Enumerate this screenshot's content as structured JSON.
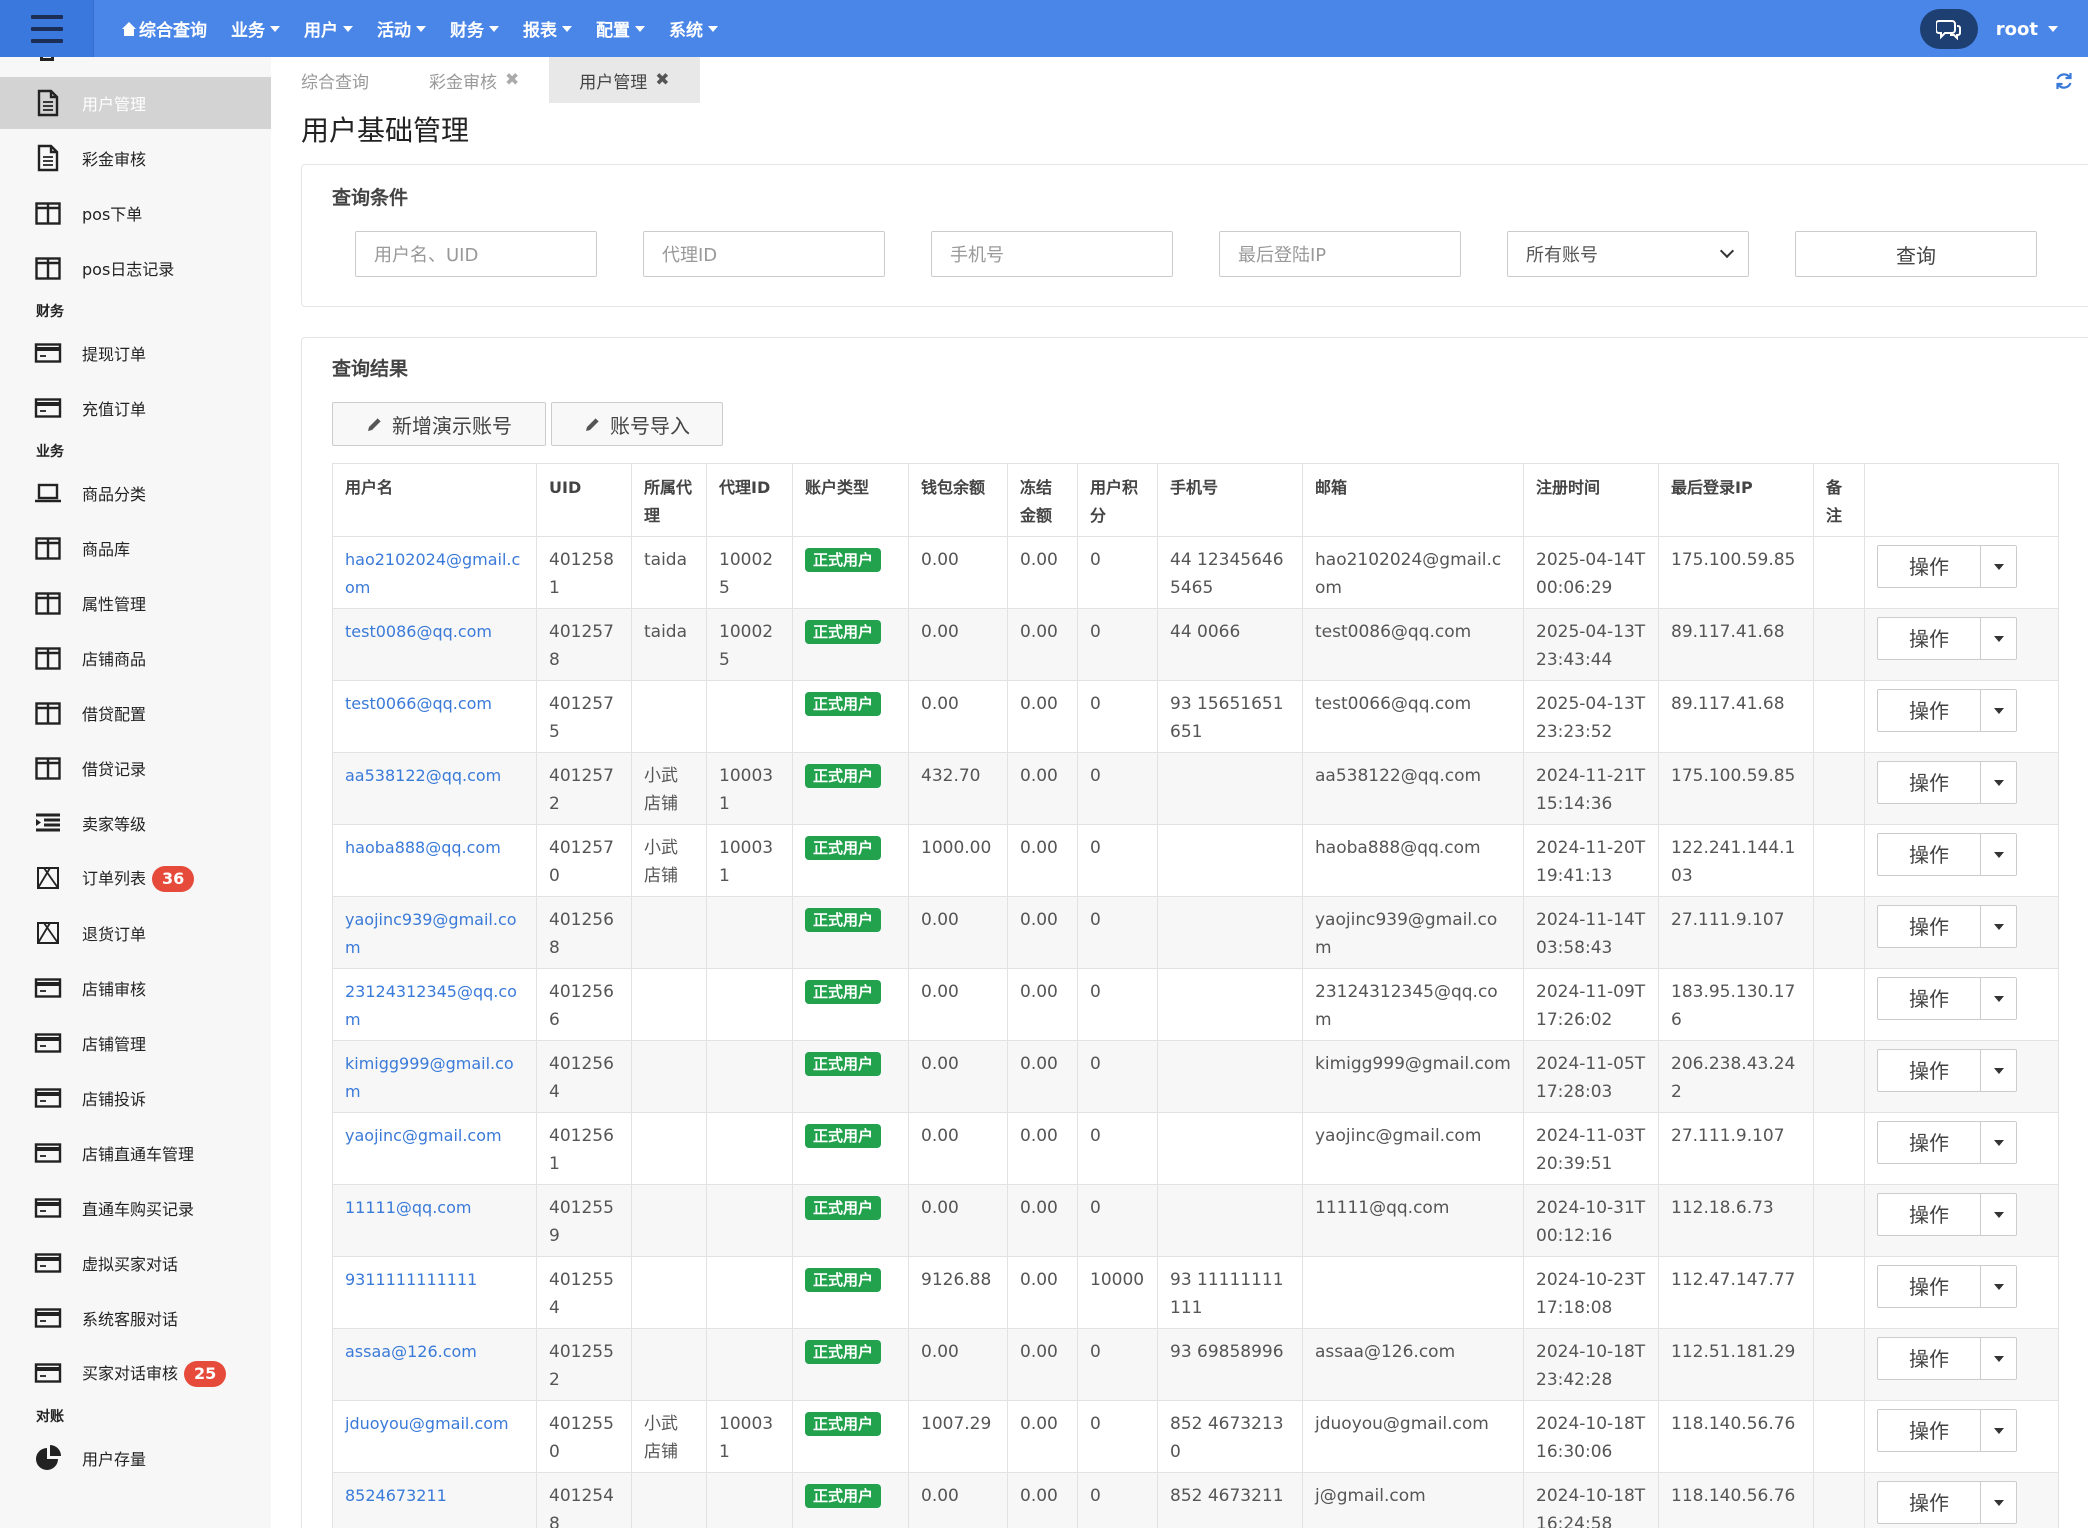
{
  "topbar": {
    "nav": [
      {
        "label": "综合查询",
        "icon": "home-icon",
        "has_caret": false
      },
      {
        "label": "业务",
        "has_caret": true
      },
      {
        "label": "用户",
        "has_caret": true
      },
      {
        "label": "活动",
        "has_caret": true
      },
      {
        "label": "财务",
        "has_caret": true
      },
      {
        "label": "报表",
        "has_caret": true
      },
      {
        "label": "配置",
        "has_caret": true
      },
      {
        "label": "系统",
        "has_caret": true
      }
    ],
    "user": "root",
    "bar_color": "#4a86e8"
  },
  "sidebar": {
    "items": [
      {
        "label": "用户管理",
        "icon": "document-icon",
        "active": true
      },
      {
        "label": "彩金审核",
        "icon": "document-icon"
      },
      {
        "label": "pos下单",
        "icon": "columns-icon"
      },
      {
        "label": "pos日志记录",
        "icon": "columns-icon"
      },
      {
        "group": "财务"
      },
      {
        "label": "提现订单",
        "icon": "card-icon"
      },
      {
        "label": "充值订单",
        "icon": "card-icon"
      },
      {
        "group": "业务"
      },
      {
        "label": "商品分类",
        "icon": "laptop-icon"
      },
      {
        "label": "商品库",
        "icon": "columns-icon"
      },
      {
        "label": "属性管理",
        "icon": "columns-icon"
      },
      {
        "label": "店铺商品",
        "icon": "columns-icon"
      },
      {
        "label": "借贷配置",
        "icon": "columns-icon"
      },
      {
        "label": "借贷记录",
        "icon": "columns-icon"
      },
      {
        "label": "卖家等级",
        "icon": "list-indent-icon"
      },
      {
        "label": "订单列表",
        "icon": "box-x-icon",
        "badge": "36"
      },
      {
        "label": "退货订单",
        "icon": "box-x-icon"
      },
      {
        "label": "店铺审核",
        "icon": "card-icon"
      },
      {
        "label": "店铺管理",
        "icon": "card-icon"
      },
      {
        "label": "店铺投诉",
        "icon": "card-icon"
      },
      {
        "label": "店铺直通车管理",
        "icon": "card-icon"
      },
      {
        "label": "直通车购买记录",
        "icon": "card-icon"
      },
      {
        "label": "虚拟买家对话",
        "icon": "card-icon"
      },
      {
        "label": "系统客服对话",
        "icon": "card-icon"
      },
      {
        "label": "买家对话审核",
        "icon": "card-icon",
        "badge": "25"
      },
      {
        "group": "对账"
      },
      {
        "label": "用户存量",
        "icon": "pie-chart-icon"
      }
    ]
  },
  "tabs": [
    {
      "label": "综合查询",
      "closable": false,
      "active": false
    },
    {
      "label": "彩金审核",
      "closable": true,
      "active": false
    },
    {
      "label": "用户管理",
      "closable": true,
      "active": true
    }
  ],
  "page_title": "用户基础管理",
  "query": {
    "title": "查询条件",
    "fields": [
      {
        "placeholder": "用户名、UID"
      },
      {
        "placeholder": "代理ID"
      },
      {
        "placeholder": "手机号"
      },
      {
        "placeholder": "最后登陆IP"
      }
    ],
    "select_value": "所有账号",
    "search_label": "查询"
  },
  "results": {
    "title": "查询结果",
    "buttons": [
      "新增演示账号",
      "账号导入"
    ],
    "columns": [
      "用户名",
      "UID",
      "所属代理",
      "代理ID",
      "账户类型",
      "钱包余额",
      "冻结金额",
      "用户积分",
      "手机号",
      "邮箱",
      "注册时间",
      "最后登录IP",
      "备注",
      ""
    ],
    "op_label": "操作",
    "type_badge_color": "#23a24d",
    "rows": [
      {
        "username": "hao2102024@gmail.com",
        "uid": "4012581",
        "agent": "taida",
        "agent_id": "100025",
        "type": "正式用户",
        "balance": "0.00",
        "frozen": "0.00",
        "points": "0",
        "phone": "44 123456465465",
        "email": "hao2102024@gmail.com",
        "reg_time": "2025-04-14T00:06:29",
        "ip": "175.100.59.85",
        "note": ""
      },
      {
        "username": "test0086@qq.com",
        "uid": "4012578",
        "agent": "taida",
        "agent_id": "100025",
        "type": "正式用户",
        "balance": "0.00",
        "frozen": "0.00",
        "points": "0",
        "phone": "44 0066",
        "email": "test0086@qq.com",
        "reg_time": "2025-04-13T23:43:44",
        "ip": "89.117.41.68",
        "note": ""
      },
      {
        "username": "test0066@qq.com",
        "uid": "4012575",
        "agent": "",
        "agent_id": "",
        "type": "正式用户",
        "balance": "0.00",
        "frozen": "0.00",
        "points": "0",
        "phone": "93 15651651651",
        "email": "test0066@qq.com",
        "reg_time": "2025-04-13T23:23:52",
        "ip": "89.117.41.68",
        "note": ""
      },
      {
        "username": "aa538122@qq.com",
        "uid": "4012572",
        "agent": "小武店铺",
        "agent_id": "100031",
        "type": "正式用户",
        "balance": "432.70",
        "frozen": "0.00",
        "points": "0",
        "phone": "",
        "email": "aa538122@qq.com",
        "reg_time": "2024-11-21T15:14:36",
        "ip": "175.100.59.85",
        "note": ""
      },
      {
        "username": "haoba888@qq.com",
        "uid": "4012570",
        "agent": "小武店铺",
        "agent_id": "100031",
        "type": "正式用户",
        "balance": "1000.00",
        "frozen": "0.00",
        "points": "0",
        "phone": "",
        "email": "haoba888@qq.com",
        "reg_time": "2024-11-20T19:41:13",
        "ip": "122.241.144.103",
        "note": ""
      },
      {
        "username": "yaojinc939@gmail.com",
        "uid": "4012568",
        "agent": "",
        "agent_id": "",
        "type": "正式用户",
        "balance": "0.00",
        "frozen": "0.00",
        "points": "0",
        "phone": "",
        "email": "yaojinc939@gmail.com",
        "reg_time": "2024-11-14T03:58:43",
        "ip": "27.111.9.107",
        "note": ""
      },
      {
        "username": "23124312345@qq.com",
        "uid": "4012566",
        "agent": "",
        "agent_id": "",
        "type": "正式用户",
        "balance": "0.00",
        "frozen": "0.00",
        "points": "0",
        "phone": "",
        "email": "23124312345@qq.com",
        "reg_time": "2024-11-09T17:26:02",
        "ip": "183.95.130.176",
        "note": ""
      },
      {
        "username": "kimigg999@gmail.com",
        "uid": "4012564",
        "agent": "",
        "agent_id": "",
        "type": "正式用户",
        "balance": "0.00",
        "frozen": "0.00",
        "points": "0",
        "phone": "",
        "email": "kimigg999@gmail.com",
        "reg_time": "2024-11-05T17:28:03",
        "ip": "206.238.43.242",
        "note": ""
      },
      {
        "username": "yaojinc@gmail.com",
        "uid": "4012561",
        "agent": "",
        "agent_id": "",
        "type": "正式用户",
        "balance": "0.00",
        "frozen": "0.00",
        "points": "0",
        "phone": "",
        "email": "yaojinc@gmail.com",
        "reg_time": "2024-11-03T20:39:51",
        "ip": "27.111.9.107",
        "note": ""
      },
      {
        "username": "11111@qq.com",
        "uid": "4012559",
        "agent": "",
        "agent_id": "",
        "type": "正式用户",
        "balance": "0.00",
        "frozen": "0.00",
        "points": "0",
        "phone": "",
        "email": "11111@qq.com",
        "reg_time": "2024-10-31T00:12:16",
        "ip": "112.18.6.73",
        "note": ""
      },
      {
        "username": "9311111111111",
        "uid": "4012554",
        "agent": "",
        "agent_id": "",
        "type": "正式用户",
        "balance": "9126.88",
        "frozen": "0.00",
        "points": "10000",
        "phone": "93 11111111111",
        "email": "",
        "reg_time": "2024-10-23T17:18:08",
        "ip": "112.47.147.77",
        "note": ""
      },
      {
        "username": "assaa@126.com",
        "uid": "4012552",
        "agent": "",
        "agent_id": "",
        "type": "正式用户",
        "balance": "0.00",
        "frozen": "0.00",
        "points": "0",
        "phone": "93 69858996",
        "email": "assaa@126.com",
        "reg_time": "2024-10-18T23:42:28",
        "ip": "112.51.181.29",
        "note": ""
      },
      {
        "username": "jduoyou@gmail.com",
        "uid": "4012550",
        "agent": "小武店铺",
        "agent_id": "100031",
        "type": "正式用户",
        "balance": "1007.29",
        "frozen": "0.00",
        "points": "0",
        "phone": "852 46732130",
        "email": "jduoyou@gmail.com",
        "reg_time": "2024-10-18T16:30:06",
        "ip": "118.140.56.76",
        "note": ""
      },
      {
        "username": "8524673211",
        "uid": "4012548",
        "agent": "",
        "agent_id": "",
        "type": "正式用户",
        "balance": "0.00",
        "frozen": "0.00",
        "points": "0",
        "phone": "852 4673211",
        "email": "j@gmail.com",
        "reg_time": "2024-10-18T16:24:58",
        "ip": "118.140.56.76",
        "note": ""
      }
    ]
  }
}
